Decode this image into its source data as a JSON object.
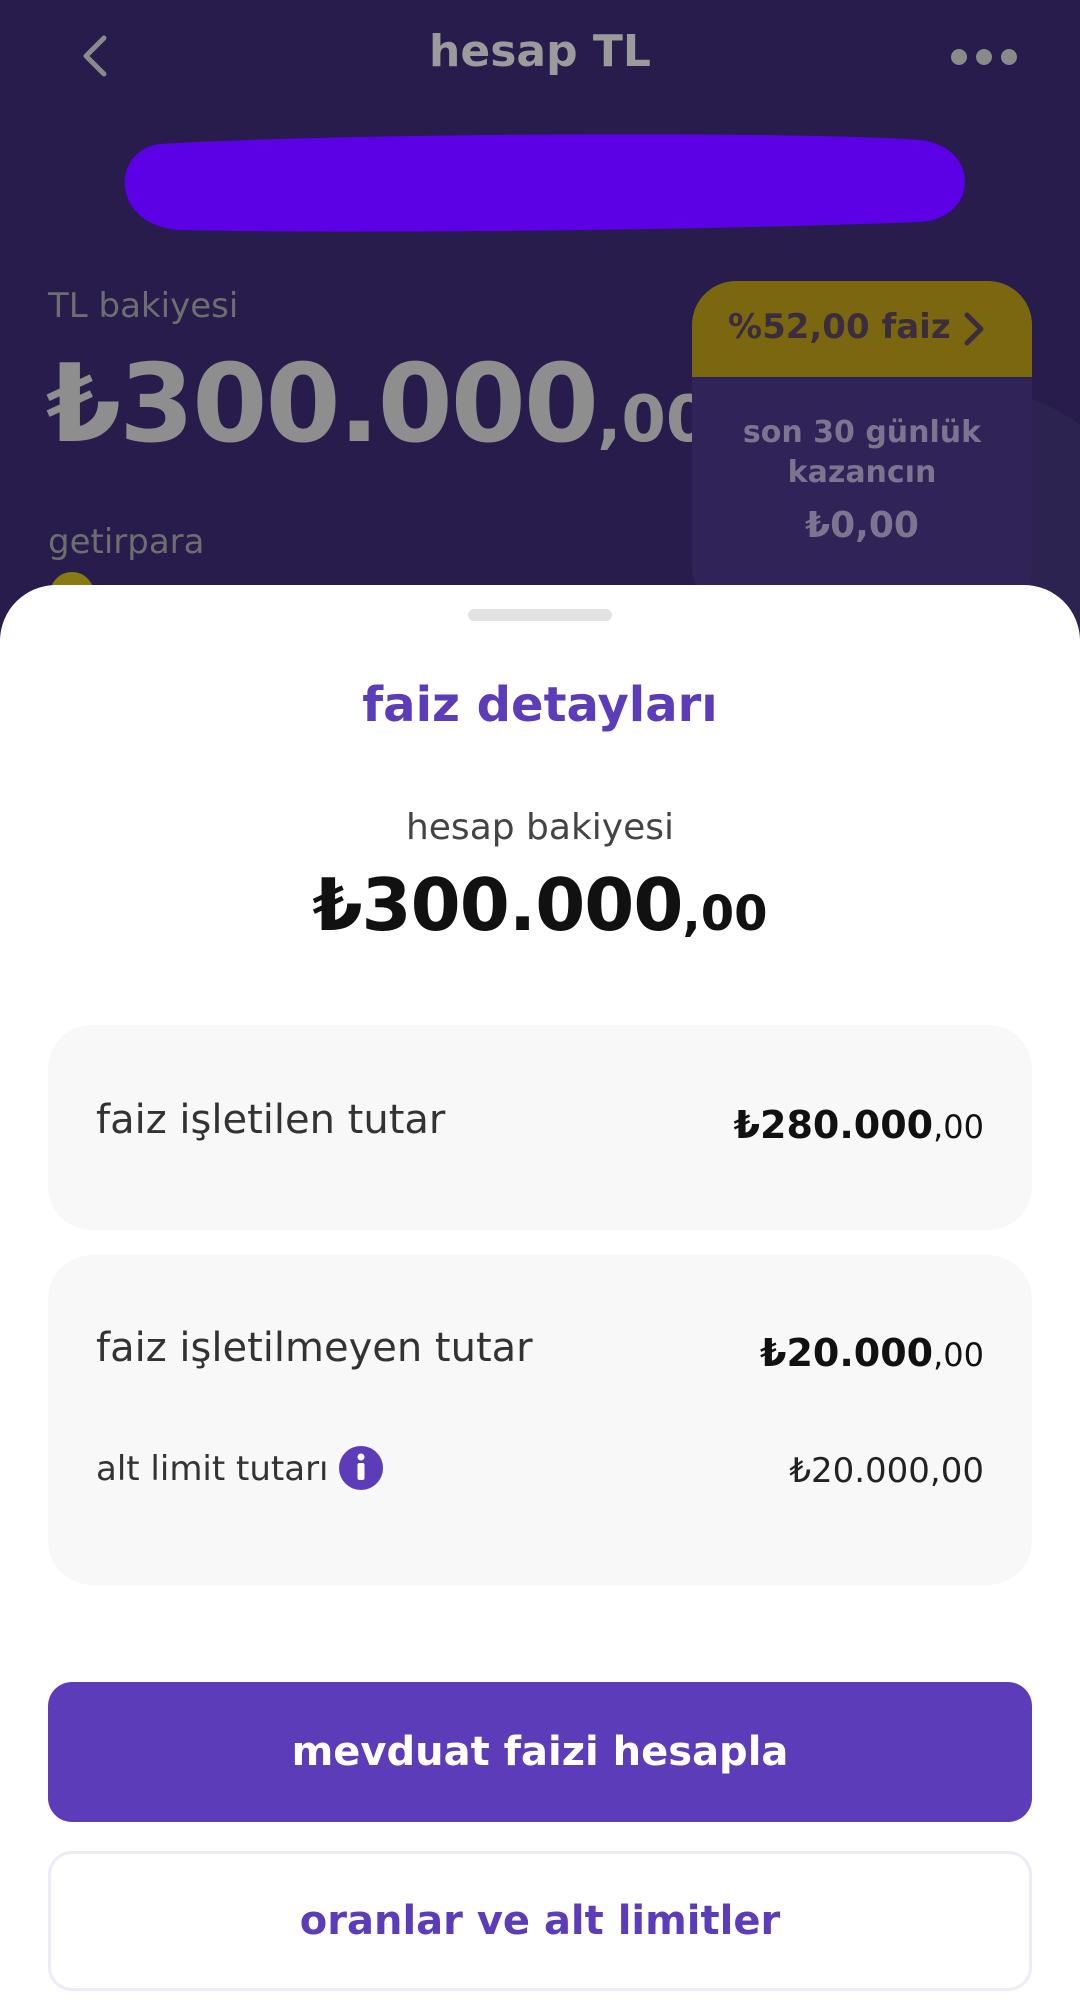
{
  "header": {
    "title": "hesap TL",
    "back_icon": "chevron-left-icon",
    "menu_icon": "more-horizontal-icon"
  },
  "account": {
    "balance_label": "TL bakiyesi",
    "balance_main": "₺300.000",
    "balance_decimals": ",00",
    "getirpara_label": "getirpara"
  },
  "rate_card": {
    "rate_text": "%52,00 faiz",
    "earnings_label_prefix": "son ",
    "earnings_label_bold": "30 günlük",
    "earnings_label_suffix": "kazancın",
    "earnings_value": "₺0,00"
  },
  "sheet": {
    "title": "faiz detayları",
    "account_balance_label": "hesap bakiyesi",
    "account_balance_main": "₺300.000",
    "account_balance_decimals": ",00",
    "interest_applied": {
      "label": "faiz işletilen tutar",
      "value_main": "₺280.000",
      "value_decimals": ",00"
    },
    "interest_not_applied": {
      "label": "faiz işletilmeyen tutar",
      "value_main": "₺20.000",
      "value_decimals": ",00"
    },
    "lower_limit": {
      "label": "alt limit tutarı",
      "value": "₺20.000,00",
      "icon": "info-icon"
    },
    "primary_button": "mevduat faizi hesapla",
    "secondary_button": "oranlar ve alt limitler"
  },
  "colors": {
    "brand_purple": "#5c3cb8",
    "header_background": "#271c4c",
    "rate_gold": "#7c6711",
    "redaction": "#5c00e6"
  }
}
